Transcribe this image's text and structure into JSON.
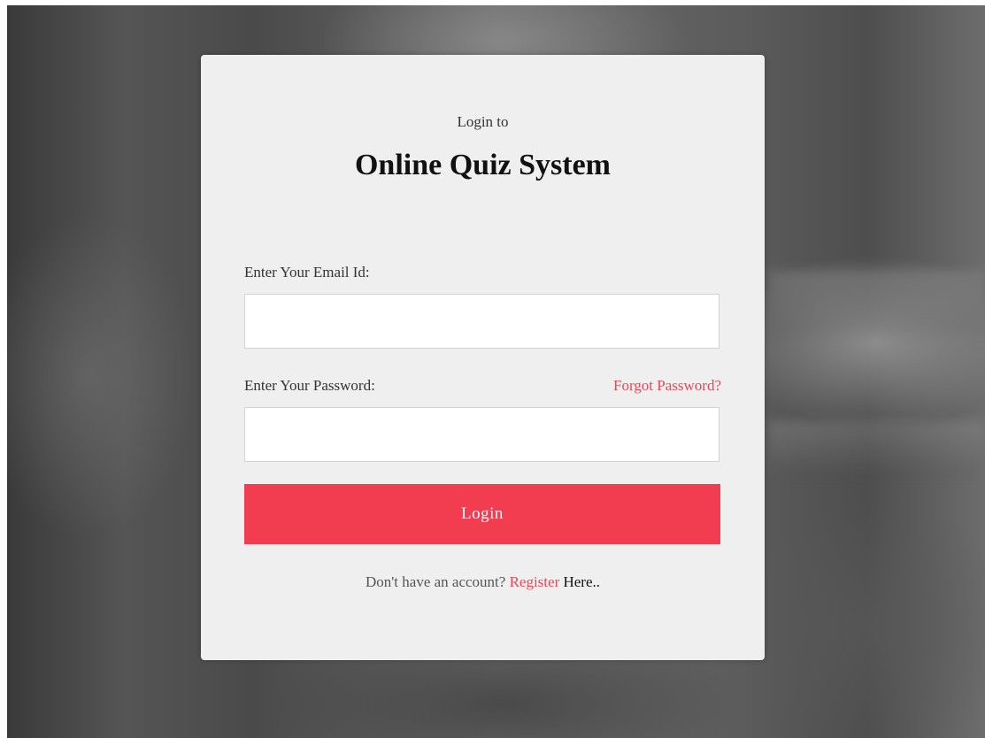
{
  "login_card": {
    "subtitle": "Login to",
    "title": "Online Quiz System",
    "email": {
      "label": "Enter Your Email Id:",
      "value": "",
      "placeholder": ""
    },
    "password": {
      "label": "Enter Your Password:",
      "value": "",
      "placeholder": ""
    },
    "forgot_password_label": "Forgot Password?",
    "login_button_label": "Login",
    "register": {
      "prefix": "Don't have an account? ",
      "link_label": "Register",
      "suffix": " Here.."
    }
  },
  "colors": {
    "accent": "#f23d50",
    "link": "#e84856",
    "card_background": "#efefef"
  }
}
